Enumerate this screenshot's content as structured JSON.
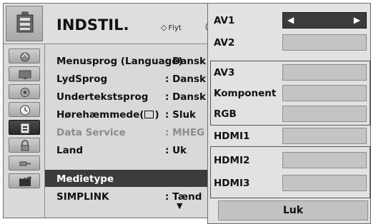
{
  "menu": {
    "title": "INDSTIL.",
    "hint_move": "Flyt",
    "items": [
      {
        "label": "Menusprog (Language)",
        "value": ": Dansk"
      },
      {
        "label": "LydSprog",
        "value": ": Dansk"
      },
      {
        "label": "Undertekstsprog",
        "value": ": Dansk"
      },
      {
        "label": "Hørehæmmede(",
        "label_suffix": ")",
        "value": ": Sluk"
      },
      {
        "label": "Data Service",
        "value": ": MHEG"
      },
      {
        "label": "Land",
        "value": ": Uk"
      },
      {
        "label": "Medietype",
        "value": ""
      },
      {
        "label": "SIMPLINK",
        "value": ": Tænd"
      }
    ]
  },
  "popup": {
    "inputs": [
      "AV1",
      "AV2",
      "AV3",
      "Komponent",
      "RGB",
      "HDMI1",
      "HDMI2",
      "HDMI3"
    ],
    "close_label": "Luk"
  }
}
